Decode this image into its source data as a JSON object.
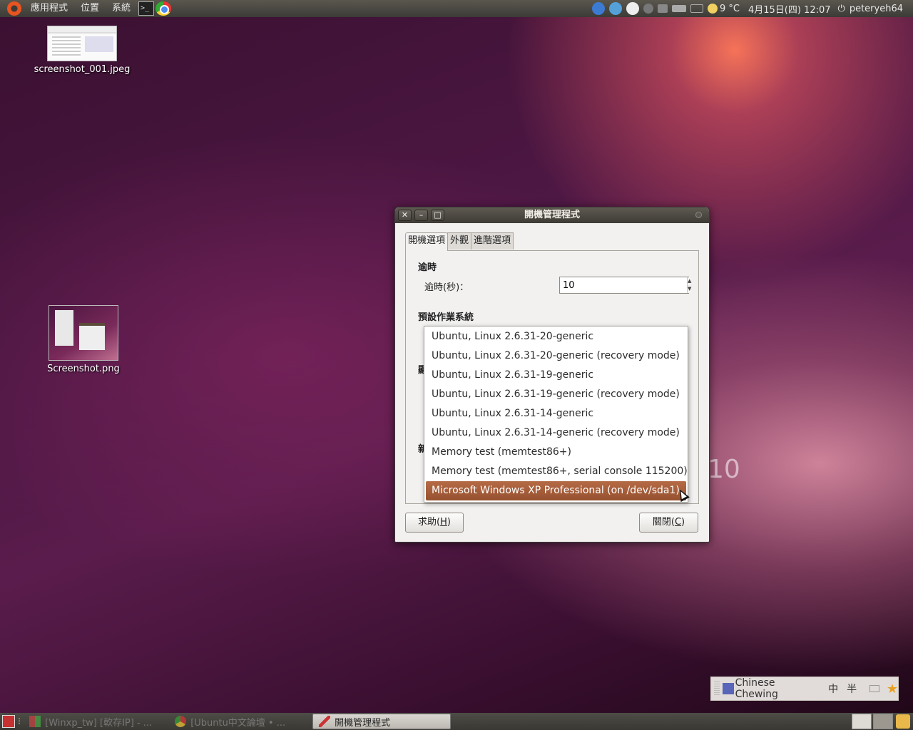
{
  "top_panel": {
    "menus": [
      "應用程式",
      "位置",
      "系統"
    ],
    "weather": "9 °C",
    "clock": "4月15日(四) 12:07",
    "user": "peteryeh64"
  },
  "desktop": {
    "icons": [
      {
        "label": "screenshot_001.jpeg"
      },
      {
        "label": "Screenshot.png"
      }
    ],
    "background_text": "10"
  },
  "window": {
    "title": "開機管理程式",
    "titlebar_buttons": {
      "close": "✕",
      "minimize": "–",
      "maximize": "□"
    },
    "tabs": [
      {
        "label": "開機選項",
        "active": true
      },
      {
        "label": "外觀",
        "active": false
      },
      {
        "label": "進階選項",
        "active": false
      }
    ],
    "timeout_section": "逾時",
    "timeout_label": "逾時(秒)：",
    "timeout_value": "10",
    "default_os_section": "預設作業系統",
    "clipped_label_1": "顯",
    "clipped_label_2": "新",
    "buttons": {
      "help_prefix": "求助(",
      "help_key": "H",
      "help_suffix": ")",
      "close_prefix": "關閉(",
      "close_key": "C",
      "close_suffix": ")"
    }
  },
  "dropdown": {
    "items": [
      "Ubuntu, Linux 2.6.31-20-generic",
      "Ubuntu, Linux 2.6.31-20-generic (recovery mode)",
      "Ubuntu, Linux 2.6.31-19-generic",
      "Ubuntu, Linux 2.6.31-19-generic (recovery mode)",
      "Ubuntu, Linux 2.6.31-14-generic",
      "Ubuntu, Linux 2.6.31-14-generic (recovery mode)",
      "Memory test (memtest86+)",
      "Memory test (memtest86+, serial console 115200)",
      "Microsoft Windows XP Professional (on /dev/sda1)"
    ],
    "selected_index": 8
  },
  "ime": {
    "name": "Chinese Chewing",
    "mode": "中",
    "width": "半"
  },
  "taskbar": {
    "tasks": [
      {
        "label": "[Winxp_tw] [軟存IP] - ...",
        "active": false
      },
      {
        "label": "[Ubuntu中文論壇 • ...",
        "active": false
      },
      {
        "label": "開機管理程式",
        "active": true
      }
    ]
  },
  "colors": {
    "selection": "#a45d3a",
    "panel": "#3c3b37",
    "accent": "#e95420"
  }
}
